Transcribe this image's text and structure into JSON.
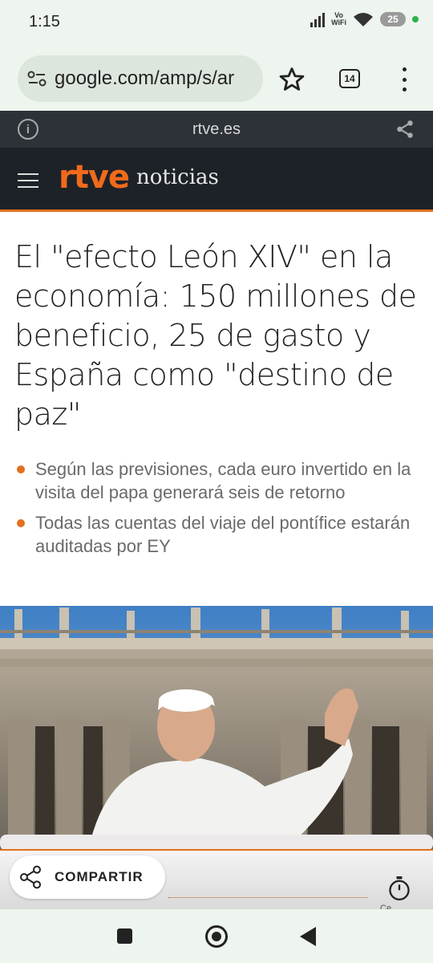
{
  "status_bar": {
    "time": "1:15",
    "vowifi_top": "Vo",
    "vowifi_bottom": "WiFi",
    "battery": "25"
  },
  "browser": {
    "url": "google.com/amp/s/ar",
    "tab_count": "14",
    "icons": [
      "site-settings-icon",
      "star-icon",
      "tabs-icon",
      "more-menu-icon"
    ]
  },
  "amp_bar": {
    "domain": "rtve.es",
    "info_icon_glyph": "i"
  },
  "header": {
    "logo": "rtve",
    "section": "noticias",
    "accent_color": "#e2701c"
  },
  "article": {
    "headline": "El \"efecto León XIV\" en la economía: 150 millones de beneficio, 25 de gasto y España como \"destino de paz\"",
    "summary": [
      "Según las previsiones, cada euro invertido en la visita del papa generará seis de retorno",
      "Todas las cuentas del viaje del pontífice estarán auditadas por EY"
    ]
  },
  "share_bar": {
    "share_label": "COMPARTIR",
    "timer_label": "Ce"
  }
}
